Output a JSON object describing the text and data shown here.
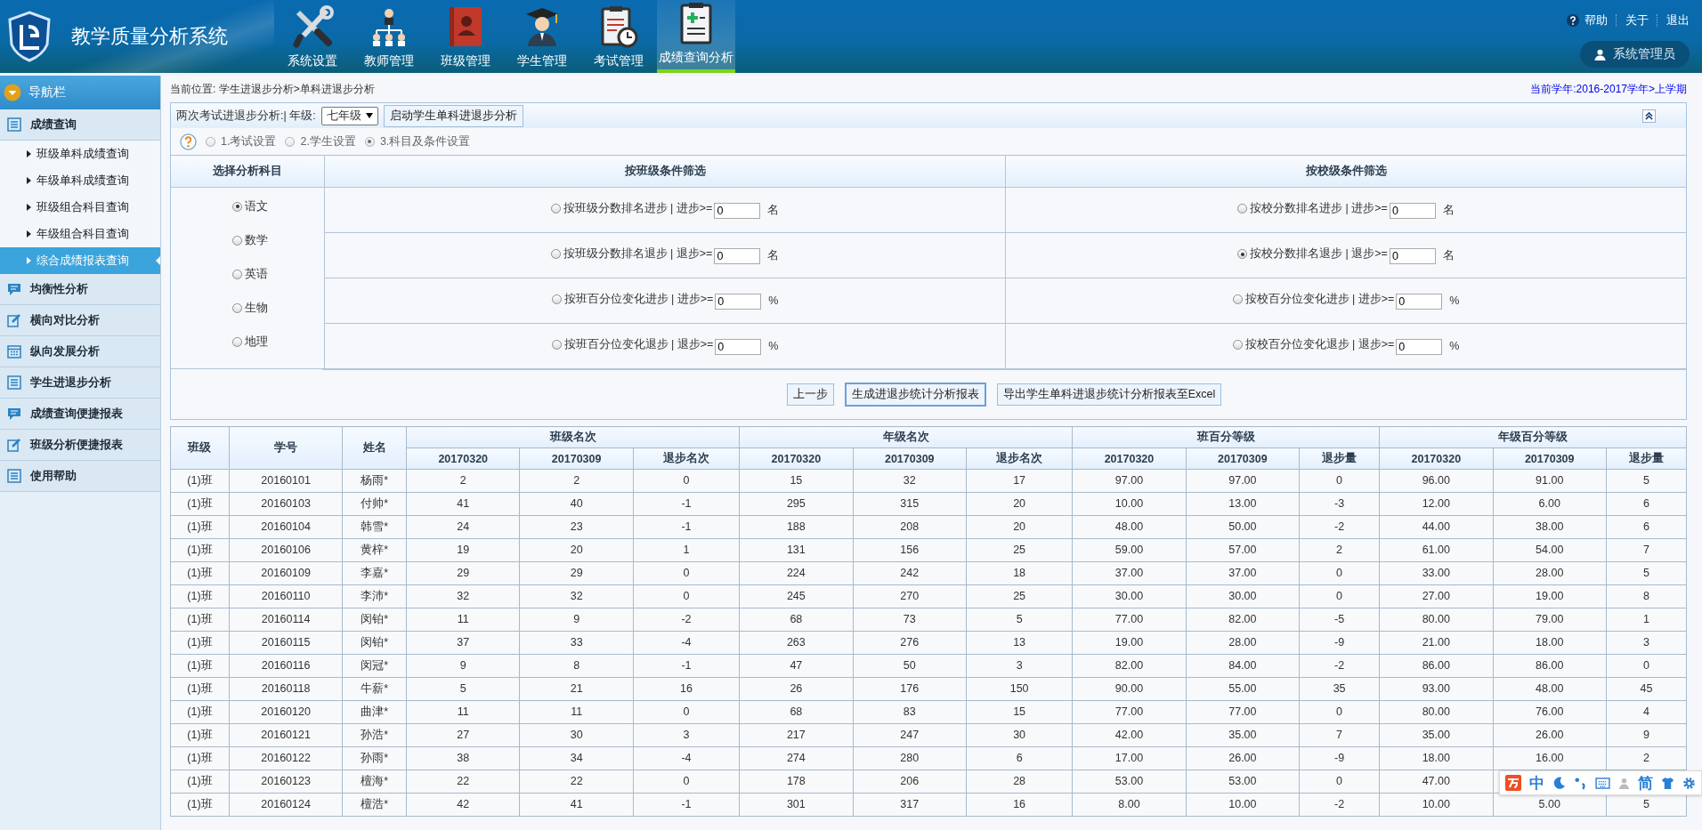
{
  "header": {
    "title": "教学质量分析系统",
    "nav": [
      {
        "label": "系统设置",
        "selected": false
      },
      {
        "label": "教师管理",
        "selected": false
      },
      {
        "label": "班级管理",
        "selected": false
      },
      {
        "label": "学生管理",
        "selected": false
      },
      {
        "label": "考试管理",
        "selected": false
      },
      {
        "label": "成绩查询分析",
        "selected": true
      }
    ],
    "links": [
      "帮助",
      "关于",
      "退出"
    ],
    "user": "系统管理员"
  },
  "sidebar": {
    "title": "导航栏",
    "groups": [
      {
        "label": "成绩查询",
        "children": [
          {
            "label": "班级单科成绩查询",
            "selected": false
          },
          {
            "label": "年级单科成绩查询",
            "selected": false
          },
          {
            "label": "班级组合科目查询",
            "selected": false
          },
          {
            "label": "年级组合科目查询",
            "selected": false
          },
          {
            "label": "综合成绩报表查询",
            "selected": true
          }
        ]
      },
      {
        "label": "均衡性分析"
      },
      {
        "label": "横向对比分析"
      },
      {
        "label": "纵向发展分析"
      },
      {
        "label": "学生进退步分析"
      },
      {
        "label": "成绩查询便捷报表"
      },
      {
        "label": "班级分析便捷报表"
      },
      {
        "label": "使用帮助"
      }
    ]
  },
  "breadcrumb": "当前位置: 学生进退步分析>单科进退步分析",
  "term": "当前学年:2016-2017学年>上学期",
  "toolbar": {
    "label": "两次考试进退步分析:| 年级:",
    "grade": "七年级",
    "start_button": "启动学生单科进退步分析"
  },
  "steps": [
    {
      "label": "1.考试设置",
      "selected": false
    },
    {
      "label": "2.学生设置",
      "selected": false
    },
    {
      "label": "3.科目及条件设置",
      "selected": true
    }
  ],
  "filters": {
    "subject_header": "选择分析科目",
    "class_header": "按班级条件筛选",
    "school_header": "按校级条件筛选",
    "subjects": [
      {
        "label": "语文",
        "selected": true
      },
      {
        "label": "数学",
        "selected": false
      },
      {
        "label": "英语",
        "selected": false
      },
      {
        "label": "生物",
        "selected": false
      },
      {
        "label": "地理",
        "selected": false
      }
    ],
    "class_conditions": [
      {
        "label": "按班级分数排名进步 | 进步>=",
        "value": "0",
        "unit": "名",
        "selected": false
      },
      {
        "label": "按班级分数排名退步 | 退步>=",
        "value": "0",
        "unit": "名",
        "selected": false
      },
      {
        "label": "按班百分位变化进步 | 进步>=",
        "value": "0",
        "unit": "%",
        "selected": false
      },
      {
        "label": "按班百分位变化退步 | 退步>=",
        "value": "0",
        "unit": "%",
        "selected": false
      }
    ],
    "school_conditions": [
      {
        "label": "按校分数排名进步 | 进步>=",
        "value": "0",
        "unit": "名",
        "selected": false
      },
      {
        "label": "按校分数排名退步 | 退步>=",
        "value": "0",
        "unit": "名",
        "selected": true
      },
      {
        "label": "按校百分位变化进步 | 进步>=",
        "value": "0",
        "unit": "%",
        "selected": false
      },
      {
        "label": "按校百分位变化退步 | 退步>=",
        "value": "0",
        "unit": "%",
        "selected": false
      }
    ]
  },
  "buttons": [
    {
      "label": "上一步",
      "focused": false
    },
    {
      "label": "生成进退步统计分析报表",
      "focused": true
    },
    {
      "label": "导出学生单科进退步统计分析报表至Excel",
      "focused": false
    }
  ],
  "table": {
    "header_rows": [
      [
        {
          "label": "班级",
          "rowspan": 2
        },
        {
          "label": "学号",
          "rowspan": 2
        },
        {
          "label": "姓名",
          "rowspan": 2
        },
        {
          "label": "班级名次",
          "colspan": 3
        },
        {
          "label": "年级名次",
          "colspan": 3
        },
        {
          "label": "班百分等级",
          "colspan": 3
        },
        {
          "label": "年级百分等级",
          "colspan": 3
        }
      ],
      [
        {
          "label": "20170320"
        },
        {
          "label": "20170309"
        },
        {
          "label": "退步名次"
        },
        {
          "label": "20170320"
        },
        {
          "label": "20170309"
        },
        {
          "label": "退步名次"
        },
        {
          "label": "20170320"
        },
        {
          "label": "20170309"
        },
        {
          "label": "退步量"
        },
        {
          "label": "20170320"
        },
        {
          "label": "20170309"
        },
        {
          "label": "退步量"
        }
      ]
    ],
    "rows": [
      [
        "(1)班",
        "20160101",
        "杨雨*",
        "2",
        "2",
        "0",
        "15",
        "32",
        "17",
        "97.00",
        "97.00",
        "0",
        "96.00",
        "91.00",
        "5"
      ],
      [
        "(1)班",
        "20160103",
        "付帅*",
        "41",
        "40",
        "-1",
        "295",
        "315",
        "20",
        "10.00",
        "13.00",
        "-3",
        "12.00",
        "6.00",
        "6"
      ],
      [
        "(1)班",
        "20160104",
        "韩雪*",
        "24",
        "23",
        "-1",
        "188",
        "208",
        "20",
        "48.00",
        "50.00",
        "-2",
        "44.00",
        "38.00",
        "6"
      ],
      [
        "(1)班",
        "20160106",
        "黄梓*",
        "19",
        "20",
        "1",
        "131",
        "156",
        "25",
        "59.00",
        "57.00",
        "2",
        "61.00",
        "54.00",
        "7"
      ],
      [
        "(1)班",
        "20160109",
        "李嘉*",
        "29",
        "29",
        "0",
        "224",
        "242",
        "18",
        "37.00",
        "37.00",
        "0",
        "33.00",
        "28.00",
        "5"
      ],
      [
        "(1)班",
        "20160110",
        "李沛*",
        "32",
        "32",
        "0",
        "245",
        "270",
        "25",
        "30.00",
        "30.00",
        "0",
        "27.00",
        "19.00",
        "8"
      ],
      [
        "(1)班",
        "20160114",
        "闵铂*",
        "11",
        "9",
        "-2",
        "68",
        "73",
        "5",
        "77.00",
        "82.00",
        "-5",
        "80.00",
        "79.00",
        "1"
      ],
      [
        "(1)班",
        "20160115",
        "闵铂*",
        "37",
        "33",
        "-4",
        "263",
        "276",
        "13",
        "19.00",
        "28.00",
        "-9",
        "21.00",
        "18.00",
        "3"
      ],
      [
        "(1)班",
        "20160116",
        "闵冠*",
        "9",
        "8",
        "-1",
        "47",
        "50",
        "3",
        "82.00",
        "84.00",
        "-2",
        "86.00",
        "86.00",
        "0"
      ],
      [
        "(1)班",
        "20160118",
        "牛薪*",
        "5",
        "21",
        "16",
        "26",
        "176",
        "150",
        "90.00",
        "55.00",
        "35",
        "93.00",
        "48.00",
        "45"
      ],
      [
        "(1)班",
        "20160120",
        "曲津*",
        "11",
        "11",
        "0",
        "68",
        "83",
        "15",
        "77.00",
        "77.00",
        "0",
        "80.00",
        "76.00",
        "4"
      ],
      [
        "(1)班",
        "20160121",
        "孙浩*",
        "27",
        "30",
        "3",
        "217",
        "247",
        "30",
        "42.00",
        "35.00",
        "7",
        "35.00",
        "26.00",
        "9"
      ],
      [
        "(1)班",
        "20160122",
        "孙雨*",
        "38",
        "34",
        "-4",
        "274",
        "280",
        "6",
        "17.00",
        "26.00",
        "-9",
        "18.00",
        "16.00",
        "2"
      ],
      [
        "(1)班",
        "20160123",
        "檀海*",
        "22",
        "22",
        "0",
        "178",
        "206",
        "28",
        "53.00",
        "53.00",
        "0",
        "47.00",
        null,
        null
      ],
      [
        "(1)班",
        "20160124",
        "檀浩*",
        "42",
        "41",
        "-1",
        "301",
        "317",
        "16",
        "8.00",
        "10.00",
        "-2",
        "10.00",
        "5.00",
        "5"
      ]
    ]
  },
  "ime": {
    "mode": "中",
    "script": "简"
  }
}
